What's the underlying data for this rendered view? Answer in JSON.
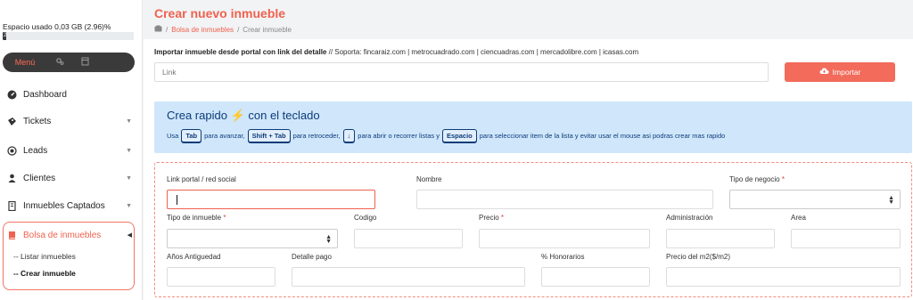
{
  "sidebar": {
    "space_label": "Espacio usado 0,03 GB (2.96)%",
    "space_fill_text": "2",
    "space_percent": 2.96,
    "menu_label": "Menú",
    "items": [
      {
        "label": "Dashboard",
        "icon": "gauge-icon"
      },
      {
        "label": "Tickets",
        "icon": "ticket-icon"
      },
      {
        "label": "Leads",
        "icon": "target-icon"
      },
      {
        "label": "Clientes",
        "icon": "user-icon"
      },
      {
        "label": "Inmuebles Captados",
        "icon": "building-icon"
      },
      {
        "label": "Bolsa de inmuebles",
        "icon": "book-icon"
      }
    ],
    "subitems": [
      "-- Listar inmuebles",
      "-- Crear inmueble"
    ]
  },
  "header": {
    "title": "Crear nuevo inmueble",
    "breadcrumb": [
      "Bolsa de inmuebles",
      "Crear inmueble"
    ]
  },
  "import": {
    "title_bold": "Importar inmueble desde portal con link del detalle",
    "title_rest": " // Soporta: fincaraiz.com | metrocuadrado.com | ciencuadras.com | mercadolibre.com | icasas.com",
    "placeholder": "Link",
    "button_label": "Importar"
  },
  "tip": {
    "title": "Crea rapido",
    "title_rest": "con el teclado",
    "usa": "Usa",
    "key_tab": "Tab",
    "t1": "para avanzar,",
    "key_shift_tab": "Shift + Tab",
    "t2": "para retroceder,",
    "key_down": "↓",
    "t3": "para abrir o recorrer listas y",
    "key_space": "Espacio",
    "t4": "para seleccionar item de la lista y evitar usar el mouse asi podras crear mas rapido"
  },
  "form": {
    "link_portal": "Link portal / red social",
    "nombre": "Nombre",
    "tipo_negocio": "Tipo de negocio",
    "tipo_inmueble": "Tipo de inmueble",
    "codigo": "Codigo",
    "precio": "Precio",
    "administracion": "Administración",
    "area": "Area",
    "anos_antiguedad": "Años Antiguedad",
    "detalle_pago": "Detalle pago",
    "honorarios": "% Honorarios",
    "precio_m2": "Precio del m2($/m2)",
    "required_mark": "*"
  },
  "colors": {
    "accent": "#f0614f",
    "tip_bg": "#cfe6fb",
    "tip_text": "#0d3c79",
    "menu_bg": "#3a3a3a"
  }
}
